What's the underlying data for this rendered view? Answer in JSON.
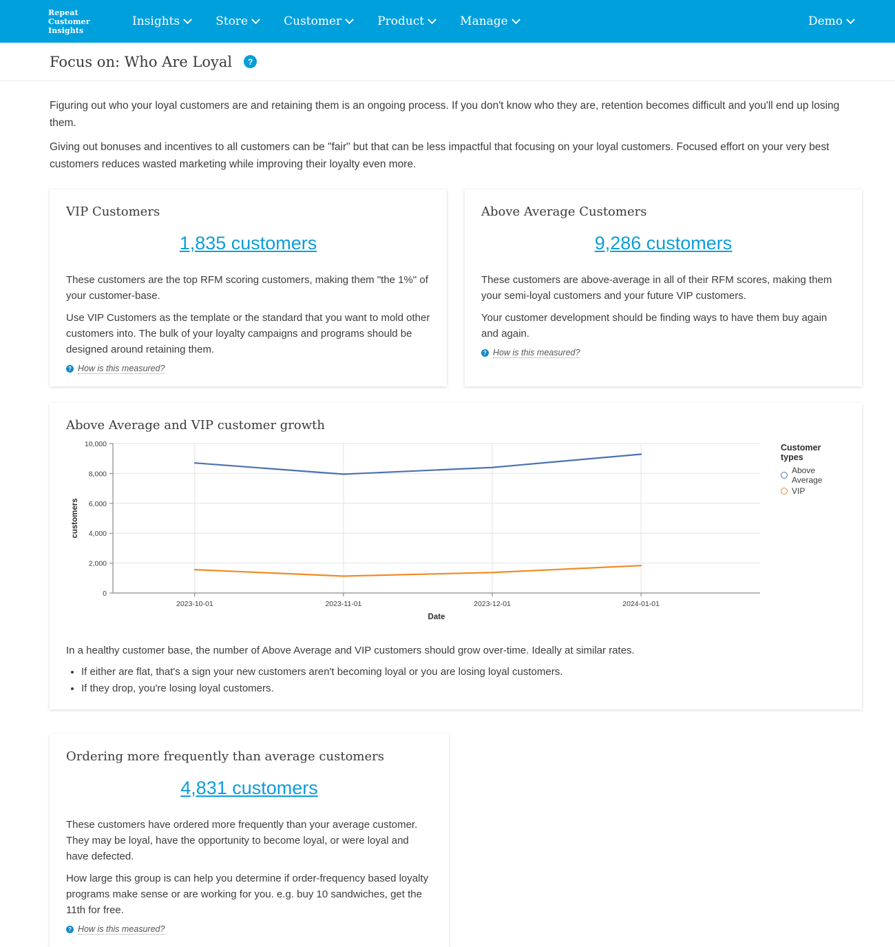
{
  "navbar": {
    "brand": "Repeat\nCustomer\nInsights",
    "brand_lines": [
      "Repeat",
      "Customer",
      "Insights"
    ],
    "items": [
      {
        "label": "Insights",
        "icon": "chevron-down-icon"
      },
      {
        "label": "Store",
        "icon": "chevron-down-icon"
      },
      {
        "label": "Customer",
        "icon": "chevron-down-icon"
      },
      {
        "label": "Product",
        "icon": "chevron-down-icon"
      },
      {
        "label": "Manage",
        "icon": "chevron-down-icon"
      }
    ],
    "account": {
      "label": "Demo",
      "icon": "chevron-down-icon"
    },
    "background": "#00a0dd"
  },
  "header": {
    "title": "Focus on: Who Are Loyal",
    "help_icon": "question-mark-icon",
    "help_glyph": "?"
  },
  "intro": {
    "paragraph1": "Figuring out who your loyal customers are and retaining them is an ongoing process. If you don't know who they are, retention becomes difficult and you'll end up losing them.",
    "paragraph2": "Giving out bonuses and incentives to all customers can be \"fair\" but that can be less impactful that focusing on your loyal customers. Focused effort on your very best customers reduces wasted marketing while improving their loyalty even more."
  },
  "cards": {
    "vip": {
      "title": "VIP Customers",
      "metric": "1,835 customers",
      "paragraph1": "These customers are the top RFM scoring customers, making them \"the 1%\" of your customer-base.",
      "paragraph2": "Use VIP Customers as the template or the standard that you want to mold other customers into. The bulk of your loyalty campaigns and programs should be designed around retaining them.",
      "measured_label": "How is this measured?",
      "measured_glyph": "?"
    },
    "above_average": {
      "title": "Above Average Customers",
      "metric": "9,286 customers",
      "paragraph1": "These customers are above-average in all of their RFM scores, making them your semi-loyal customers and your future VIP customers.",
      "paragraph2": "Your customer development should be finding ways to have them buy again and again.",
      "measured_label": "How is this measured?",
      "measured_glyph": "?"
    },
    "frequent": {
      "title": "Ordering more frequently than average customers",
      "metric": "4,831 customers",
      "paragraph1": "These customers have ordered more frequently than your average customer. They may be loyal, have the opportunity to become loyal, or were loyal and have defected.",
      "paragraph2": "How large this group is can help you determine if order-frequency based loyalty programs make sense or are working for you. e.g. buy 10 sandwiches, get the 11th for free.",
      "measured_label": "How is this measured?",
      "measured_glyph": "?"
    }
  },
  "growth_card": {
    "title": "Above Average and VIP customer growth",
    "note": "In a healthy customer base, the number of Above Average and VIP customers should grow over-time. Ideally at similar rates.",
    "bullets": [
      "If either are flat, that's a sign your new customers aren't becoming loyal or you are losing loyal customers.",
      "If they drop, you're losing loyal customers."
    ],
    "legend_title": "Customer types"
  },
  "chart_data": {
    "type": "line",
    "title": "Above Average and VIP customer growth",
    "xlabel": "Date",
    "ylabel": "customers",
    "x": [
      "2023-10-01",
      "2023-11-01",
      "2023-12-01",
      "2024-01-01"
    ],
    "xtick_labels": [
      "2023-10-01",
      "2023-11-01",
      "2023-12-01",
      "2024-01-01"
    ],
    "ytick_labels": [
      "0",
      "2,000",
      "4,000",
      "6,000",
      "8,000",
      "10,000"
    ],
    "yticks": [
      0,
      2000,
      4000,
      6000,
      8000,
      10000
    ],
    "ylim": [
      0,
      10000
    ],
    "grid": true,
    "legend_position": "right",
    "series": [
      {
        "name": "Above Average",
        "color": "#4a72b0",
        "values": [
          8700,
          7950,
          8400,
          9286
        ]
      },
      {
        "name": "VIP",
        "color": "#f08a24",
        "values": [
          1560,
          1130,
          1370,
          1835
        ]
      }
    ]
  },
  "colors": {
    "brand_blue": "#00a0dd",
    "link_blue": "#0d9ddb",
    "series_above_average": "#4a72b0",
    "series_vip": "#f08a24",
    "text": "#3c3c3c"
  }
}
